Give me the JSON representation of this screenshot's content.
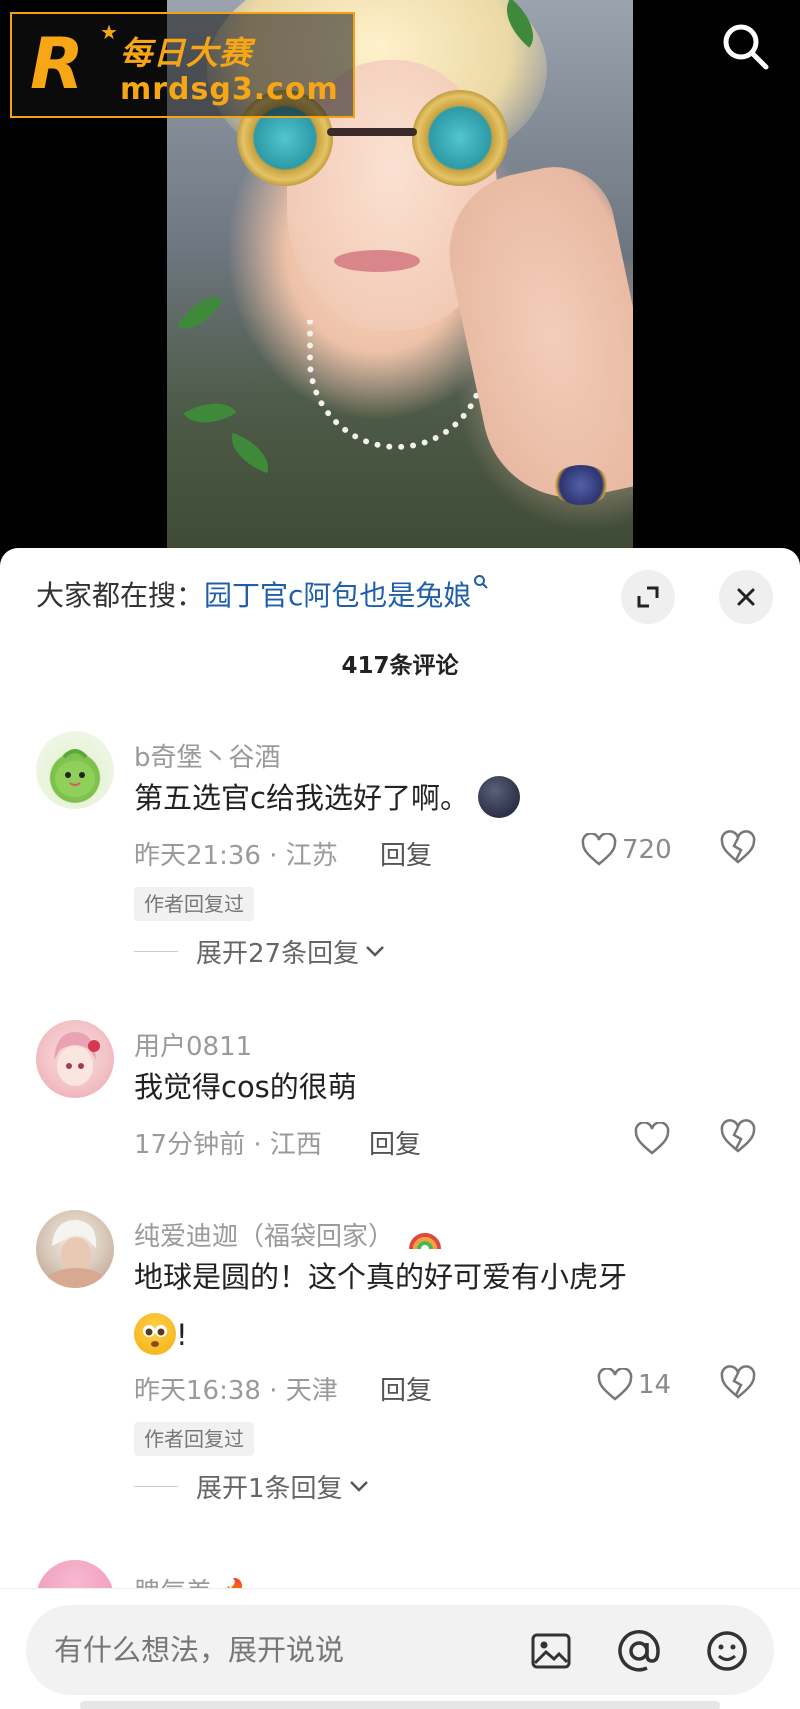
{
  "watermark": {
    "logo_letter": "R",
    "title": "每日大赛",
    "url": "mrdsg3.com"
  },
  "header": {
    "search_icon": "search-icon"
  },
  "sheet": {
    "search_prefix": "大家都在搜：",
    "search_term": "园丁官c阿包也是兔娘",
    "comment_count": "417条评论",
    "expand_icon": "expand-icon",
    "close_icon": "close-icon"
  },
  "comments": [
    {
      "username": "b奇堡丶谷酒",
      "content": "第五选官c给我选好了啊。",
      "emoji": "dark-round-emoji",
      "time_location": "昨天21:36 · 江苏",
      "reply": "回复",
      "likes": "720",
      "author_tag": "作者回复过",
      "expand_label": "展开27条回复"
    },
    {
      "username": "用户0811",
      "content": "我觉得cos的很萌",
      "time_location": "17分钟前 · 江西",
      "reply": "回复",
      "likes": ""
    },
    {
      "username": "纯爱迪迦（福袋回家）",
      "username_emoji": "rainbow-emoji",
      "content_line1": "地球是圆的！这个真的好可爱有小虎牙",
      "content_line2": "!",
      "emoji": "pleading-face-emoji",
      "time_location": "昨天16:38 · 天津",
      "reply": "回复",
      "likes": "14",
      "author_tag": "作者回复过",
      "expand_label": "展开1条回复"
    },
    {
      "username": "脾气差"
    }
  ],
  "bottom_bar": {
    "placeholder": "有什么想法，展开说说",
    "image_icon": "image-icon",
    "mention_icon": "at-mention-icon",
    "emoji_icon": "emoji-icon"
  }
}
